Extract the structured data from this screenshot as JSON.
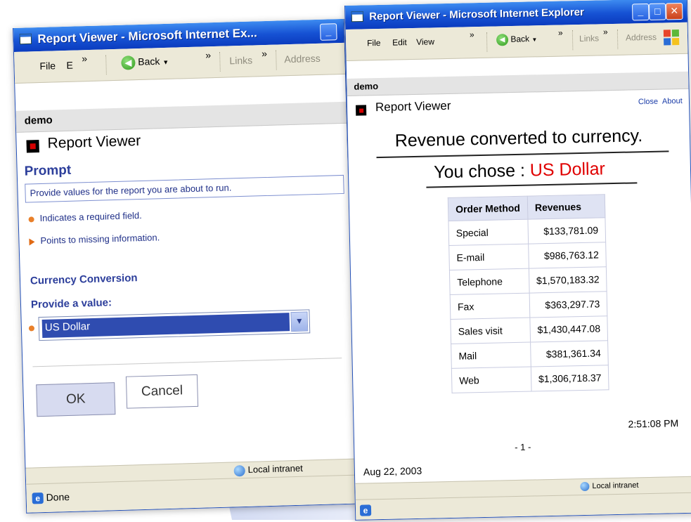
{
  "left_window": {
    "title": "Report Viewer - Microsoft Internet Ex...",
    "menu": {
      "file": "File",
      "edit": "E",
      "chevron1": "»",
      "back": "Back",
      "chevron2": "»",
      "links": "Links",
      "chevron3": "»",
      "address": "Address"
    },
    "header": "demo",
    "report_viewer": "Report Viewer",
    "prompt": {
      "title": "Prompt",
      "instructions": "Provide values for the report you are about to run.",
      "required_note": "Indicates a required field.",
      "missing_note": "Points to missing information."
    },
    "currency_section": {
      "label": "Currency Conversion",
      "provide_label": "Provide a value:",
      "selected": "US Dollar"
    },
    "buttons": {
      "ok": "OK",
      "cancel": "Cancel"
    },
    "status": {
      "text": "Done",
      "zone": "Local intranet"
    }
  },
  "right_window": {
    "title": "Report Viewer - Microsoft Internet Explorer",
    "menu": {
      "file": "File",
      "edit": "Edit",
      "view": "View",
      "chevron1": "»",
      "back": "Back",
      "chevron2": "»",
      "links": "Links",
      "chevron3": "»",
      "address": "Address"
    },
    "header": "demo",
    "report_viewer": "Report Viewer",
    "links": {
      "close": "Close",
      "about": "About"
    },
    "report": {
      "title": "Revenue converted to currency.",
      "chose_prefix": "You chose : ",
      "chose_value": "US Dollar",
      "columns": [
        "Order Method",
        "Revenues"
      ],
      "rows": [
        [
          "Special",
          "$133,781.09"
        ],
        [
          "E-mail",
          "$986,763.12"
        ],
        [
          "Telephone",
          "$1,570,183.32"
        ],
        [
          "Fax",
          "$363,297.73"
        ],
        [
          "Sales visit",
          "$1,430,447.08"
        ],
        [
          "Mail",
          "$381,361.34"
        ],
        [
          "Web",
          "$1,306,718.37"
        ]
      ],
      "time": "2:51:08 PM",
      "page": "- 1 -",
      "date": "Aug 22, 2003"
    },
    "status": {
      "zone": "Local intranet"
    }
  },
  "colors": {
    "title_blue": "#1652d4",
    "prompt_blue": "#2c3e9b",
    "red_accent": "#e00000",
    "beam": "#4a6cc8"
  }
}
